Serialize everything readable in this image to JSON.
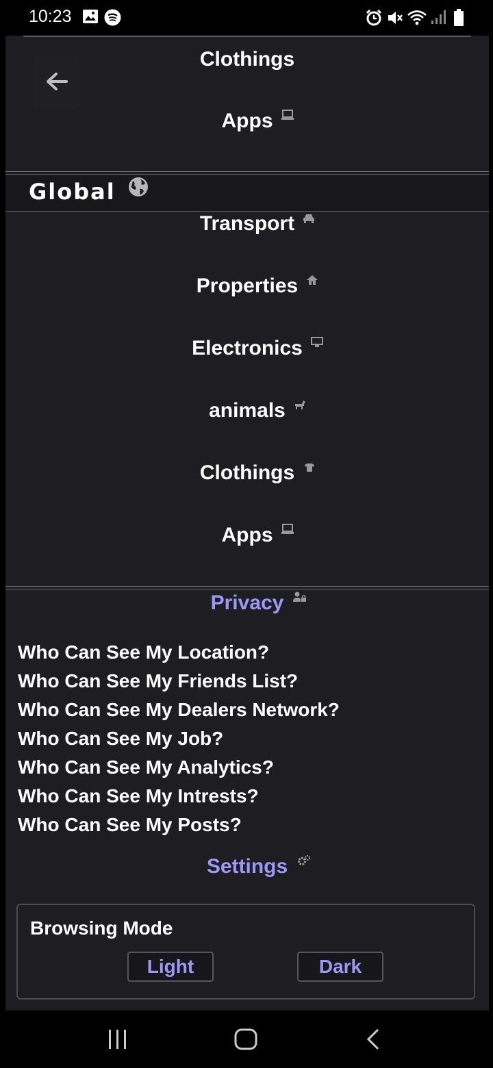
{
  "status_bar": {
    "time": "10:23",
    "left_icons": [
      "image-icon",
      "spotify-icon"
    ],
    "right_icons": [
      "alarm-icon",
      "mute-icon",
      "wifi-icon",
      "signal-icon",
      "battery-icon"
    ]
  },
  "top_categories": [
    {
      "label": "Clothings",
      "icon": "shirt-icon"
    },
    {
      "label": "Apps",
      "icon": "laptop-icon"
    }
  ],
  "global": {
    "title": "Global",
    "icon": "globe-icon"
  },
  "global_categories": [
    {
      "label": "Transport",
      "icon": "car-icon"
    },
    {
      "label": "Properties",
      "icon": "home-icon"
    },
    {
      "label": "Electronics",
      "icon": "monitor-icon"
    },
    {
      "label": "animals",
      "icon": "horse-icon"
    },
    {
      "label": "Clothings",
      "icon": "shirt-icon"
    },
    {
      "label": "Apps",
      "icon": "laptop-icon"
    }
  ],
  "privacy": {
    "title": "Privacy",
    "icon": "user-lock-icon",
    "items": [
      "Who Can See My Location?",
      "Who Can See My Friends List?",
      "Who Can See My Dealers Network?",
      "Who Can See My Job?",
      "Who Can See My Analytics?",
      "Who Can See My Intrests?",
      "Who Can See My Posts?"
    ]
  },
  "settings": {
    "title": "Settings",
    "icon": "gears-icon",
    "browsing_mode": {
      "title": "Browsing Mode",
      "light_label": "Light",
      "dark_label": "Dark"
    }
  },
  "colors": {
    "accent": "#9d98f5",
    "background": "#1e1e22",
    "text": "#ffffff"
  }
}
